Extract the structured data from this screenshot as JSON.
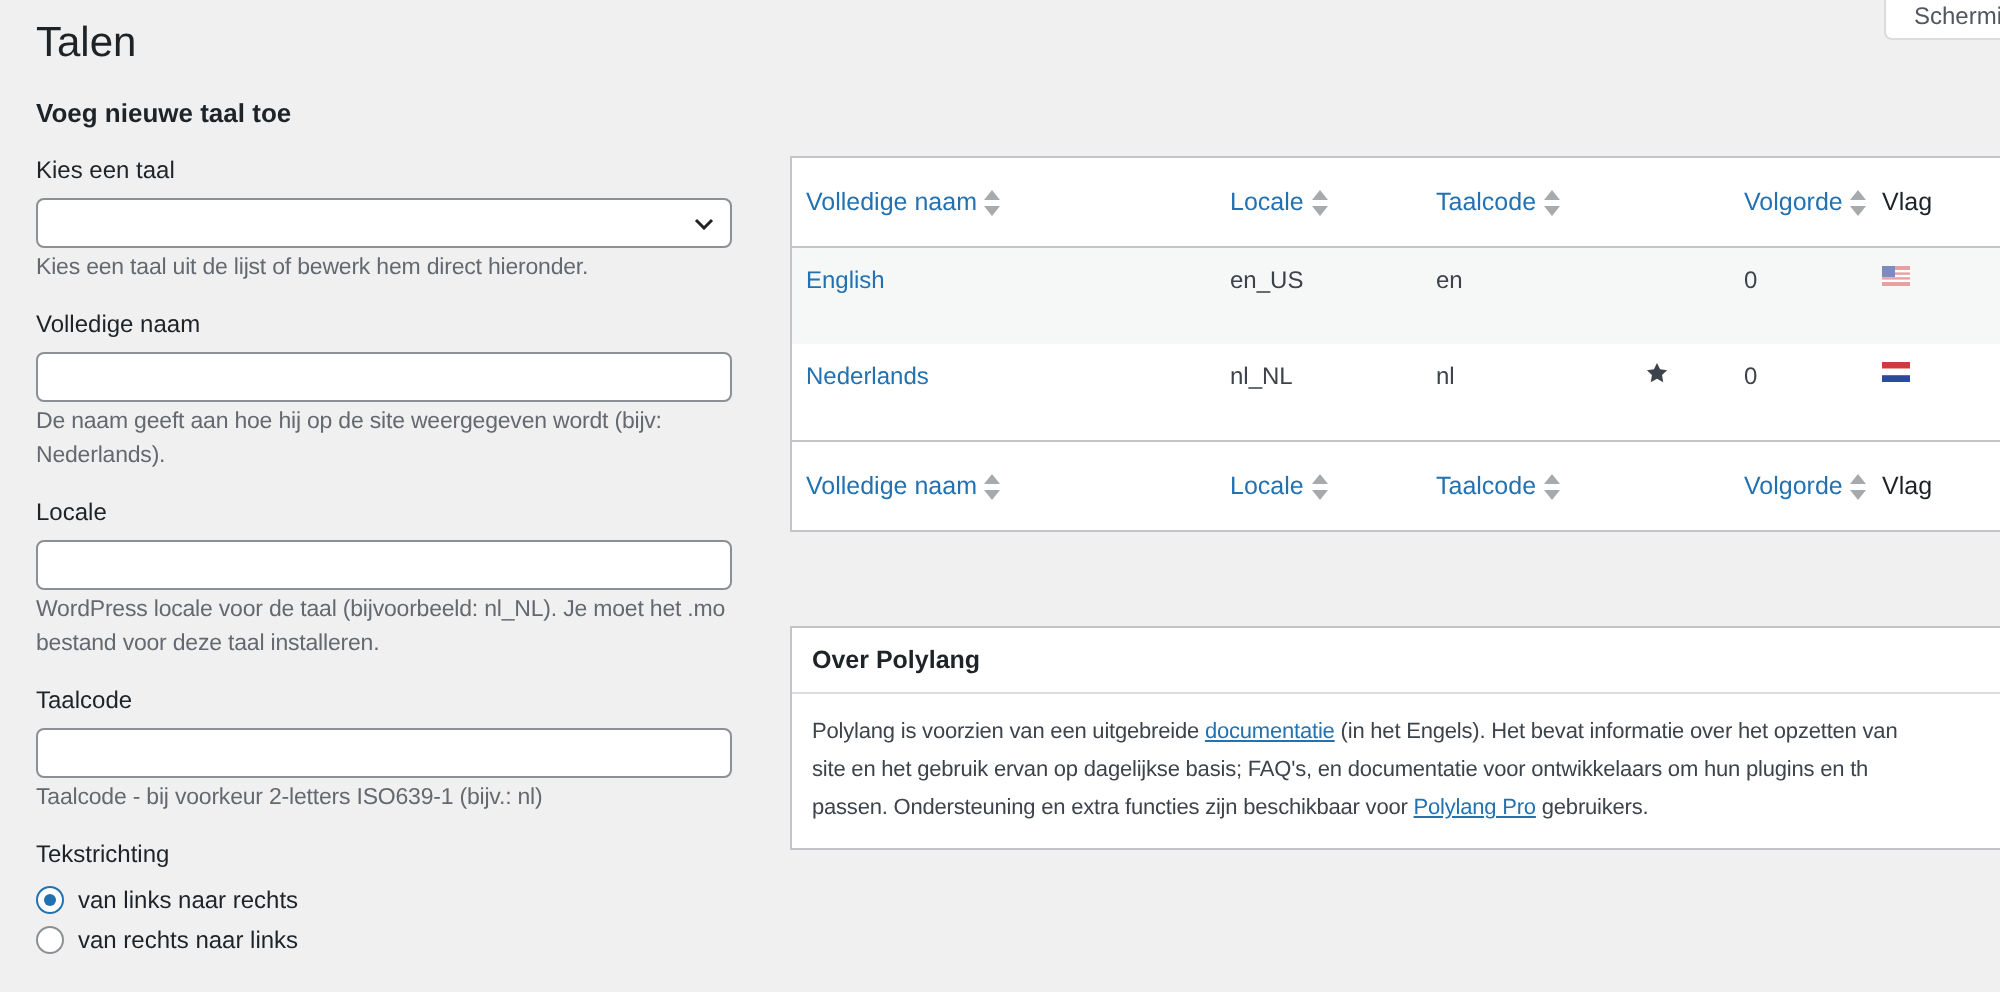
{
  "title": "Talen",
  "screen_options_button": "Schermi",
  "form": {
    "heading": "Voeg nieuwe taal toe",
    "fields": [
      {
        "kind": "select",
        "label": "Kies een taal",
        "help": "Kies een taal uit de lijst of bewerk hem direct hieronder."
      },
      {
        "kind": "text",
        "label": "Volledige naam",
        "help": "De naam geeft aan hoe hij op de site weergegeven wordt (bijv: Nederlands)."
      },
      {
        "kind": "text",
        "label": "Locale",
        "help": "WordPress locale voor de taal (bijvoorbeeld: nl_NL). Je moet het .mo bestand voor deze taal installeren."
      },
      {
        "kind": "text",
        "label": "Taalcode",
        "help": "Taalcode - bij voorkeur 2-letters ISO639-1 (bijv.: nl)"
      },
      {
        "kind": "radio",
        "label": "Tekstrichting",
        "options": [
          {
            "label": "van links naar rechts",
            "selected": true
          },
          {
            "label": "van rechts naar links",
            "selected": false
          }
        ]
      }
    ]
  },
  "table": {
    "columns": [
      {
        "label": "Volledige naam",
        "sortable": true
      },
      {
        "label": "Locale",
        "sortable": true
      },
      {
        "label": "Taalcode",
        "sortable": true
      },
      {
        "label": "Volgorde",
        "sortable": true
      },
      {
        "label": "Vlag",
        "sortable": false
      }
    ],
    "rows": [
      {
        "name": "English",
        "locale": "en_US",
        "code": "en",
        "default": false,
        "order": "0",
        "kind": "us"
      },
      {
        "name": "Nederlands",
        "locale": "nl_NL",
        "code": "nl",
        "default": true,
        "order": "0",
        "kind": "nl"
      }
    ],
    "footer_columns": [
      {
        "label": "Volledige naam",
        "sortable": true
      },
      {
        "label": "Locale",
        "sortable": true
      },
      {
        "label": "Taalcode",
        "sortable": true
      },
      {
        "label": "Volgorde",
        "sortable": true
      },
      {
        "label": "Vlag",
        "sortable": false
      }
    ]
  },
  "about": {
    "title": "Over Polylang",
    "lines": [
      [
        {
          "text": "Polylang is voorzien van een uitgebreide "
        },
        {
          "text": "documentatie",
          "link": true
        },
        {
          "text": " (in het Engels). Het bevat informatie over het opzetten van"
        }
      ],
      [
        {
          "text": "site en het gebruik ervan op dagelijkse basis; FAQ's, en documentatie voor ontwikkelaars om hun plugins en th"
        }
      ],
      [
        {
          "text": "passen. Ondersteuning en extra functies zijn beschikbaar voor "
        },
        {
          "text": "Polylang Pro",
          "link": true
        },
        {
          "text": " gebruikers."
        }
      ]
    ]
  }
}
